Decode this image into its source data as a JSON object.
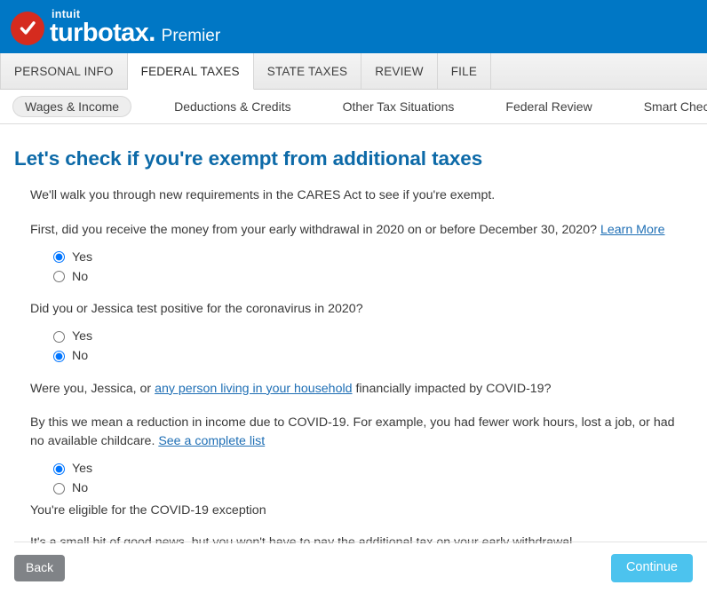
{
  "header": {
    "brand_intuit": "intuit",
    "brand_product": "turbotax",
    "brand_suffix": ".",
    "edition": "Premier",
    "bg_color": "#0077c5",
    "logo_color": "#d52b1e",
    "logo_icon": "check-circle-icon"
  },
  "tabs": [
    {
      "label": "PERSONAL INFO",
      "active": false
    },
    {
      "label": "FEDERAL TAXES",
      "active": true
    },
    {
      "label": "STATE TAXES",
      "active": false
    },
    {
      "label": "REVIEW",
      "active": false
    },
    {
      "label": "FILE",
      "active": false
    }
  ],
  "subnav": [
    {
      "label": "Wages & Income",
      "active": true
    },
    {
      "label": "Deductions & Credits",
      "active": false
    },
    {
      "label": "Other Tax Situations",
      "active": false
    },
    {
      "label": "Federal Review",
      "active": false
    },
    {
      "label": "Smart Check",
      "active": false
    }
  ],
  "main": {
    "title": "Let's check if you're exempt from additional taxes",
    "title_color": "#0d6aa8",
    "intro": "We'll walk you through new requirements in the CARES Act to see if you're exempt.",
    "q1": {
      "text_before": "First, did you receive the money from your early withdrawal in 2020 on or before December 30, 2020?",
      "link": "Learn More",
      "options": [
        {
          "label": "Yes",
          "selected": true
        },
        {
          "label": "No",
          "selected": false
        }
      ]
    },
    "q2": {
      "text": "Did you or Jessica test positive for the coronavirus in 2020?",
      "options": [
        {
          "label": "Yes",
          "selected": false
        },
        {
          "label": "No",
          "selected": true
        }
      ]
    },
    "q3": {
      "text_before": "Were you, Jessica, or ",
      "link": "any person living in your household",
      "text_after": " financially impacted by COVID-19?",
      "helper_before": "By this we mean a reduction in income due to COVID-19. For example, you had fewer work hours, lost a job, or had no available childcare. ",
      "helper_link": "See a complete list",
      "options": [
        {
          "label": "Yes",
          "selected": true
        },
        {
          "label": "No",
          "selected": false
        }
      ]
    },
    "result_heading": "You're eligible for the COVID-19 exception",
    "result_detail": "It's a small bit of good news, but you won't have to pay the additional tax on your early withdrawal."
  },
  "footer": {
    "back_label": "Back",
    "continue_label": "Continue",
    "back_color": "#808387",
    "continue_color": "#4cc3ee"
  }
}
